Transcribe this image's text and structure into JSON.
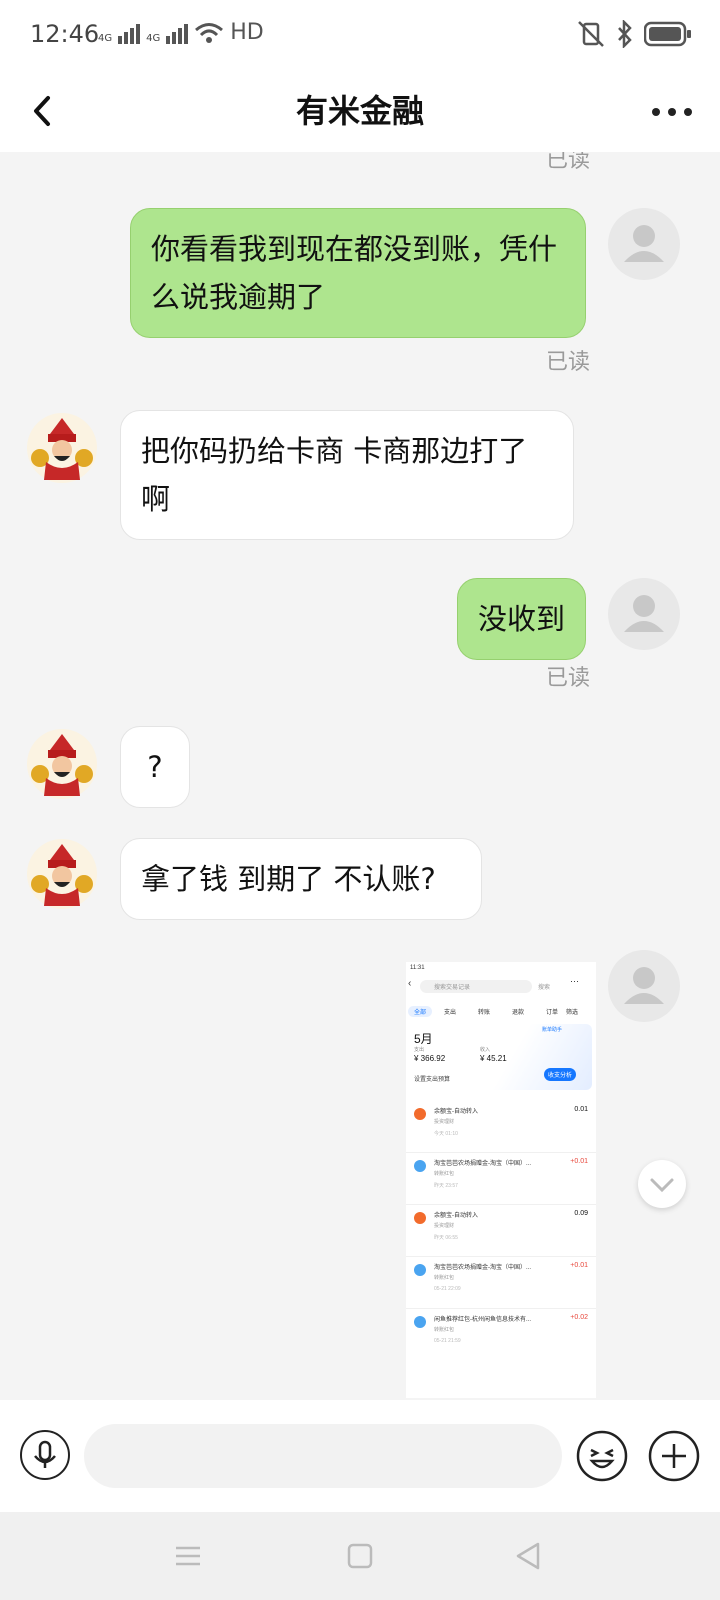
{
  "status_bar": {
    "time": "12:46",
    "network1": "4G",
    "network2": "4G",
    "hd": "HD"
  },
  "header": {
    "title": "有米金融"
  },
  "messages": [
    {
      "read_label": "已读"
    },
    {
      "direction": "out",
      "text": "你看看我到现在都没到账，凭什么说我逾期了",
      "read_label": "已读"
    },
    {
      "direction": "in",
      "text": "把你码扔给卡商 卡商那边打了啊"
    },
    {
      "direction": "out",
      "text": "没收到",
      "read_label": "已读"
    },
    {
      "direction": "in",
      "text": "?"
    },
    {
      "direction": "in",
      "text": "拿了钱 到期了 不认账?"
    }
  ],
  "screenshot": {
    "time": "11:31",
    "search_placeholder": "搜索交易记录",
    "search_button": "搜索",
    "tabs": [
      "全部",
      "支出",
      "转账",
      "退款",
      "订单",
      "筛选"
    ],
    "month": "5月",
    "spend_label": "支出",
    "spend_value": "¥ 366.92",
    "income_label": "收入",
    "income_value": "¥ 45.21",
    "budget_label": "设置支出预算",
    "analysis_button": "收支分析",
    "bill_tag": "账单助手",
    "transactions": [
      {
        "title": "余额宝-自动转入",
        "sub": "投资理财",
        "time": "今天 01:10",
        "amount": "0.01",
        "positive": false
      },
      {
        "title": "淘宝芭芭农场捐赠金-淘宝（中国）...",
        "sub": "转账红包",
        "time": "昨天 23:57",
        "amount": "+0.01",
        "positive": true
      },
      {
        "title": "余额宝-自动转入",
        "sub": "投资理财",
        "time": "昨天 06:55",
        "amount": "0.09",
        "positive": false
      },
      {
        "title": "淘宝芭芭农场捐赠金-淘宝（中国）...",
        "sub": "转账红包",
        "time": "05-21 22:09",
        "amount": "+0.01",
        "positive": true
      },
      {
        "title": "闲鱼推荐红包-杭州闲鱼信息技术有...",
        "sub": "转账红包",
        "time": "05-21 21:59",
        "amount": "+0.02",
        "positive": true
      }
    ]
  },
  "colors": {
    "outgoing_bubble": "#aee58e",
    "incoming_bubble": "#ffffff",
    "positive_amount": "#e8473b",
    "accent_blue": "#1677ff"
  },
  "icons": [
    "back-arrow-icon",
    "more-dots-icon",
    "microphone-icon",
    "emoji-icon",
    "plus-icon",
    "chevron-down-icon",
    "menu-icon",
    "home-square-icon",
    "back-triangle-icon"
  ]
}
